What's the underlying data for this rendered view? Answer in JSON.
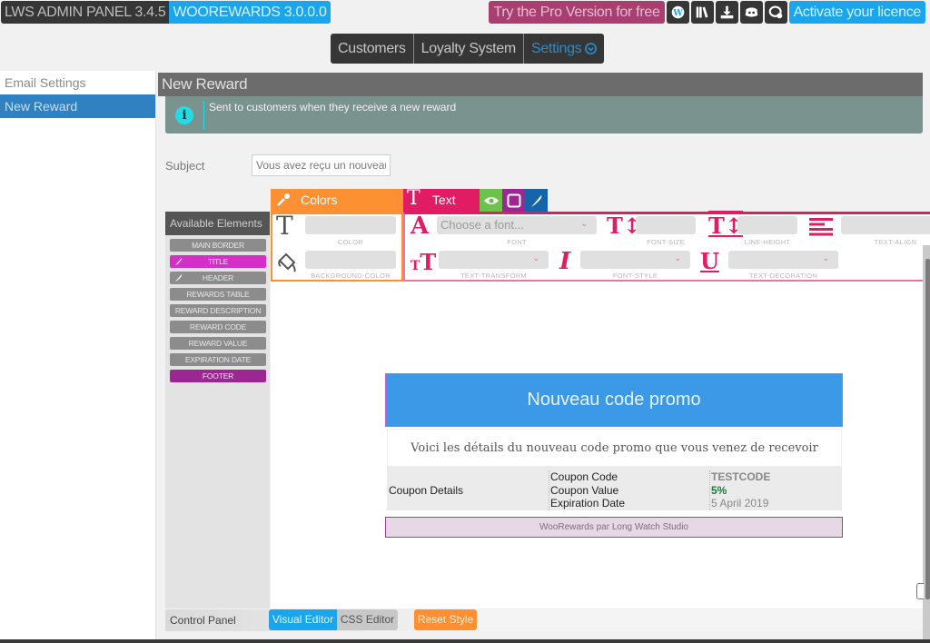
{
  "topbar": {
    "panel_name": "LWS ADMIN PANEL 3.4.5",
    "plugin_name": "WOOREWARDS 3.0.0.0",
    "pro_label": "Try the Pro Version for free",
    "icons": [
      "wordpress-icon",
      "library-icon",
      "download-icon",
      "discord-icon",
      "support-chat-icon"
    ],
    "licence_label": "Activate your licence"
  },
  "mainnav": {
    "items": [
      {
        "label": "Customers"
      },
      {
        "label": "Loyalty System"
      },
      {
        "label": "Settings",
        "active": true
      }
    ]
  },
  "sidebar": {
    "items": [
      {
        "label": "Email Settings"
      },
      {
        "label": "New Reward",
        "active": true
      }
    ]
  },
  "page": {
    "title": "New Reward",
    "info": "Sent to customers when they receive a new reward",
    "subject_label": "Subject",
    "subject_value": "Vous avez reçu un nouveau"
  },
  "elements": {
    "header": "Available Elements",
    "items": [
      {
        "label": "MAIN BORDER"
      },
      {
        "label": "TITLE",
        "selected": true
      },
      {
        "label": "HEADER"
      },
      {
        "label": "REWARDS TABLE"
      },
      {
        "label": "REWARD DESCRIPTION"
      },
      {
        "label": "REWARD CODE"
      },
      {
        "label": "REWARD VALUE"
      },
      {
        "label": "EXPIRATION DATE"
      },
      {
        "label": "FOOTER"
      }
    ]
  },
  "style_panel": {
    "colors_tab": "Colors",
    "text_tab": "Text",
    "color_label": "COLOR",
    "bg_color_label": "BACKGROUND-COLOR",
    "font_placeholder": "Choose a font...",
    "font_label": "FONT",
    "font_size_label": "FONT-SIZE",
    "line_height_label": "LINE-HEIGHT",
    "text_align_label": "TEXT-ALIGN",
    "text_transform_label": "TEXT-TRANSFORM",
    "font_style_label": "FONT-STYLE",
    "text_decoration_label": "TEXT-DECORATION",
    "accent_colors": {
      "colors": "#fd9032",
      "text": "#e21c63",
      "view": "#6cc24a",
      "border": "#9c2793",
      "feather": "#1565a8"
    }
  },
  "email": {
    "title": "Nouveau code promo",
    "description": "Voici les détails du nouveau code promo que vous venez de recevoir",
    "coupon_label": "Coupon Details",
    "keys": [
      "Coupon Code",
      "Coupon Value",
      "Expiration Date"
    ],
    "code": "TESTCODE",
    "value": "5%",
    "expiration": "5 April 2019",
    "footer": "WooRewards par Long Watch Studio"
  },
  "bottom": {
    "control_panel": "Control Panel",
    "visual_editor": "Visual Editor",
    "css_editor": "CSS Editor",
    "reset_style": "Reset Style"
  }
}
